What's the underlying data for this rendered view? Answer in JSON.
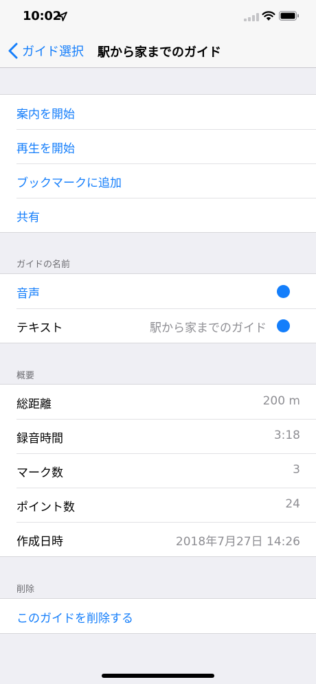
{
  "status_bar": {
    "time": "10:02"
  },
  "nav": {
    "back_label": "ガイド選択",
    "title": "駅から家までのガイド"
  },
  "actions": [
    {
      "label": "案内を開始"
    },
    {
      "label": "再生を開始"
    },
    {
      "label": "ブックマークに追加"
    },
    {
      "label": "共有"
    }
  ],
  "name_section": {
    "header": "ガイドの名前",
    "rows": [
      {
        "label": "音声",
        "value": ""
      },
      {
        "label": "テキスト",
        "value": "駅から家までのガイド"
      }
    ]
  },
  "summary_section": {
    "header": "概要",
    "rows": [
      {
        "label": "総距離",
        "value": "200 m"
      },
      {
        "label": "録音時間",
        "value": "3:18"
      },
      {
        "label": "マーク数",
        "value": "3"
      },
      {
        "label": "ポイント数",
        "value": "24"
      },
      {
        "label": "作成日時",
        "value": "2018年7月27日 14:26"
      }
    ]
  },
  "delete_section": {
    "header": "削除",
    "action_label": "このガイドを削除する"
  },
  "colors": {
    "accent": "#147efb",
    "background": "#efeff4",
    "secondary_text": "#8e8e93",
    "header_text": "#6d6d72"
  },
  "icons": [
    "location-arrow-icon",
    "signal-icon",
    "wifi-icon",
    "battery-icon",
    "chevron-left-icon"
  ]
}
